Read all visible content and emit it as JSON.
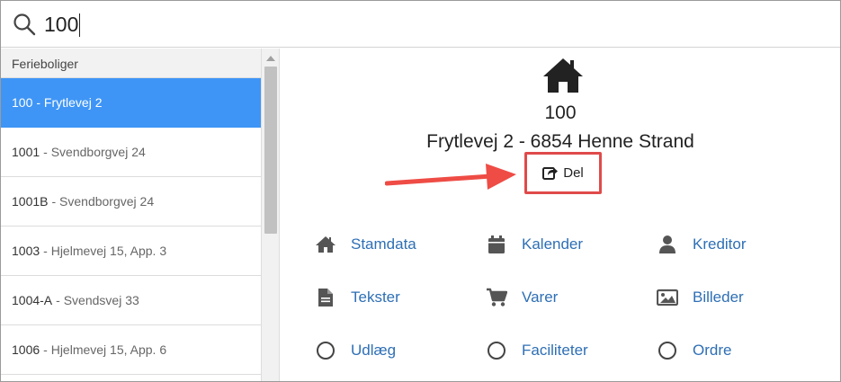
{
  "search": {
    "value": "100"
  },
  "sidebar": {
    "header": "Ferieboliger",
    "items": [
      {
        "number": "100",
        "address": "- Frytlevej 2"
      },
      {
        "number": "1001",
        "address": "- Svendborgvej 24"
      },
      {
        "number": "1001B",
        "address": "- Svendborgvej 24"
      },
      {
        "number": "1003",
        "address": "- Hjelmevej 15, App. 3"
      },
      {
        "number": "1004-A",
        "address": "- Svendsvej 33"
      },
      {
        "number": "1006",
        "address": "- Hjelmevej 15, App. 6"
      }
    ],
    "selected_index": 0
  },
  "property": {
    "number": "100",
    "address": "Frytlevej 2 - 6854 Henne Strand",
    "share_label": "Del"
  },
  "nav": {
    "stamdata": "Stamdata",
    "kalender": "Kalender",
    "kreditor": "Kreditor",
    "tekster": "Tekster",
    "varer": "Varer",
    "billeder": "Billeder",
    "udlaeg": "Udlæg",
    "faciliteter": "Faciliteter",
    "ordre": "Ordre"
  },
  "colors": {
    "selected_bg": "#3e95f6",
    "link": "#2e6fb5",
    "highlight": "#e04a4a",
    "arrow": "#ee4c45"
  }
}
